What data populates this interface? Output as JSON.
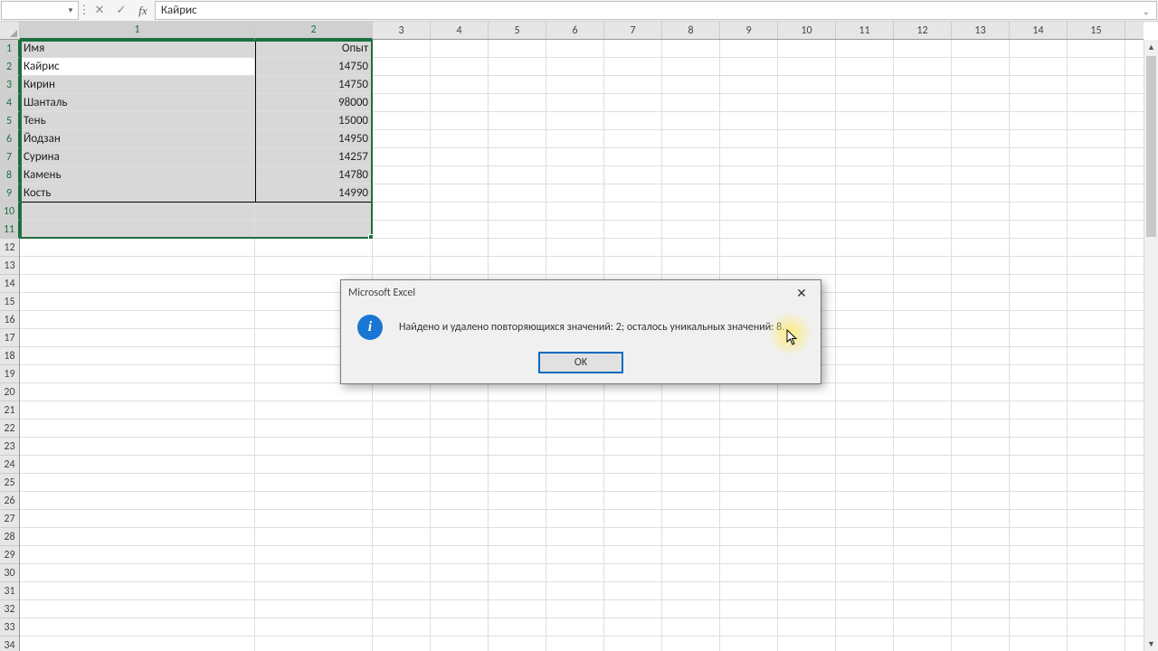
{
  "formula_bar": {
    "name_box": "",
    "value": "Кайрис"
  },
  "columns": {
    "visible": [
      1,
      2,
      3,
      4,
      5,
      6,
      7,
      8,
      9,
      10,
      11,
      12,
      13,
      14,
      15
    ],
    "selected": [
      1,
      2
    ],
    "widths": {
      "1": 260,
      "2": 130,
      "default": 64
    }
  },
  "rows": {
    "count": 34,
    "selected_from": 1,
    "selected_to": 11
  },
  "headers": {
    "c1": "Имя",
    "c2": "Опыт"
  },
  "data": [
    {
      "name": "Кайрис",
      "exp": "14750"
    },
    {
      "name": "Кирин",
      "exp": "14750"
    },
    {
      "name": "Шанталь",
      "exp": "98000"
    },
    {
      "name": "Тень",
      "exp": "15000"
    },
    {
      "name": "Йодзан",
      "exp": "14950"
    },
    {
      "name": "Сурина",
      "exp": "14257"
    },
    {
      "name": "Камень",
      "exp": "14780"
    },
    {
      "name": "Кость",
      "exp": "14990"
    }
  ],
  "dialog": {
    "title": "Microsoft Excel",
    "message": "Найдено и удалено повторяющихся значений: 2; осталось уникальных значений: 8.",
    "ok": "OK"
  },
  "icons": {
    "cancel": "✕",
    "accept": "✓",
    "fx": "fx",
    "divider": "⋮",
    "dropdown": "▾",
    "expand": "⌄",
    "up": "▲",
    "down": "▼",
    "info": "i"
  }
}
